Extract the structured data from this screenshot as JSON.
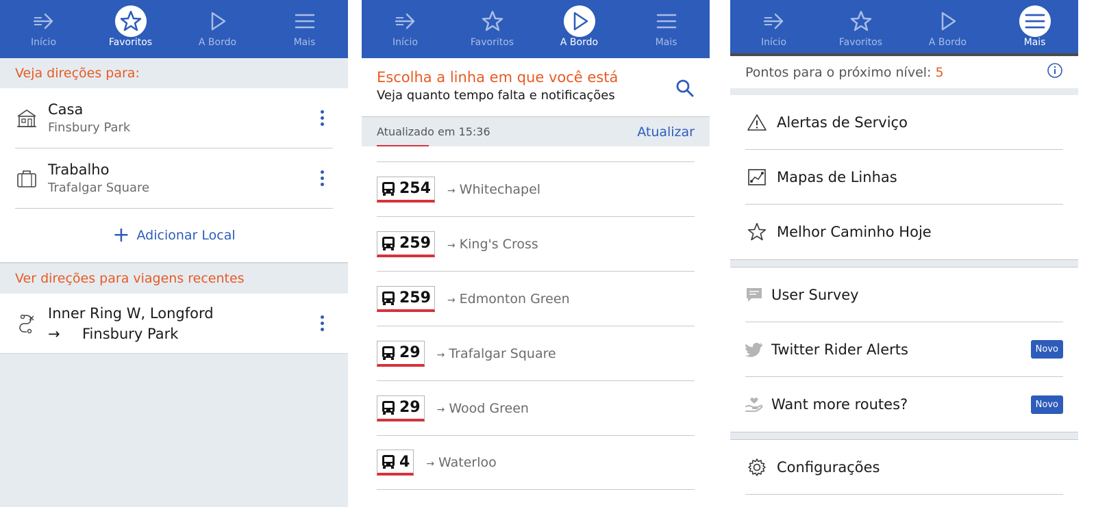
{
  "tabs": {
    "inicio": "Início",
    "favoritos": "Favoritos",
    "a_bordo": "A Bordo",
    "mais": "Mais"
  },
  "favorites": {
    "directions_header": "Veja direções para:",
    "items": [
      {
        "title": "Casa",
        "subtitle": "Finsbury Park",
        "icon": "house-icon"
      },
      {
        "title": "Trabalho",
        "subtitle": "Trafalgar Square",
        "icon": "briefcase-icon"
      }
    ],
    "add_label": "Adicionar Local",
    "recent_header": "Ver direções para viagens recentes",
    "recent": [
      {
        "from": "Inner Ring W, Longford",
        "arrow": "→",
        "to": "Finsbury Park"
      }
    ]
  },
  "onboard": {
    "title": "Escolha a linha em que você está",
    "subtitle": "Veja quanto tempo falta e notificações",
    "updated": "Atualizado em 15:36",
    "refresh": "Atualizar",
    "lines": [
      {
        "number": "254",
        "destination": "Whitechapel"
      },
      {
        "number": "259",
        "destination": "King's Cross"
      },
      {
        "number": "259",
        "destination": "Edmonton Green"
      },
      {
        "number": "29",
        "destination": "Trafalgar Square"
      },
      {
        "number": "29",
        "destination": "Wood Green"
      },
      {
        "number": "4",
        "destination": "Waterloo"
      }
    ]
  },
  "more": {
    "points_label": "Pontos para o próximo nível:",
    "points_value": "5",
    "group1": [
      {
        "label": "Alertas de Serviço",
        "icon": "warning-icon"
      },
      {
        "label": "Mapas de Linhas",
        "icon": "route-map-icon"
      },
      {
        "label": "Melhor Caminho Hoje",
        "icon": "star-icon"
      }
    ],
    "group2": [
      {
        "label": "User Survey",
        "icon": "chat-bubble-icon",
        "badge": ""
      },
      {
        "label": "Twitter Rider Alerts",
        "icon": "twitter-icon",
        "badge": "Novo"
      },
      {
        "label": "Want more routes?",
        "icon": "hand-heart-icon",
        "badge": "Novo"
      }
    ],
    "group3": [
      {
        "label": "Configurações",
        "icon": "gear-icon"
      }
    ]
  },
  "colors": {
    "brand_blue": "#2d5cba",
    "accent_orange": "#e85a24",
    "bus_red": "#d6333b"
  }
}
